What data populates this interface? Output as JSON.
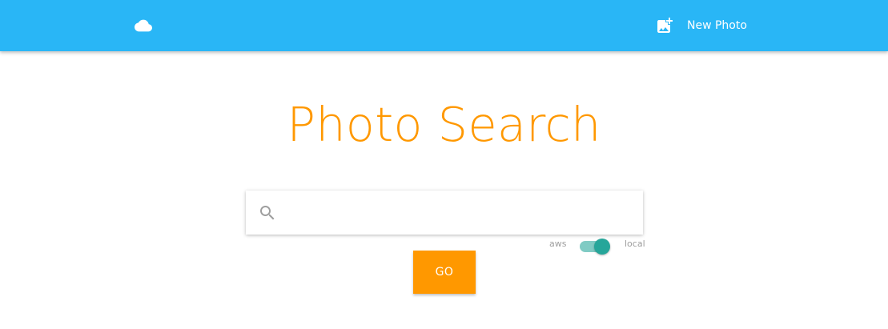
{
  "navbar": {
    "brand_icon": "cloud-icon",
    "new_photo": {
      "icon": "add-photo-icon",
      "label": "New Photo"
    }
  },
  "main": {
    "title": "Photo Search",
    "search": {
      "icon": "search-icon",
      "value": "",
      "placeholder": ""
    },
    "source_switch": {
      "off_label": "aws",
      "on_label": "local",
      "state": "local"
    },
    "go_label": "GO"
  },
  "colors": {
    "navbar": "#29b6f6",
    "accent": "#ff9800",
    "switch_thumb": "#26a69a",
    "switch_track": "#80cbc4"
  }
}
